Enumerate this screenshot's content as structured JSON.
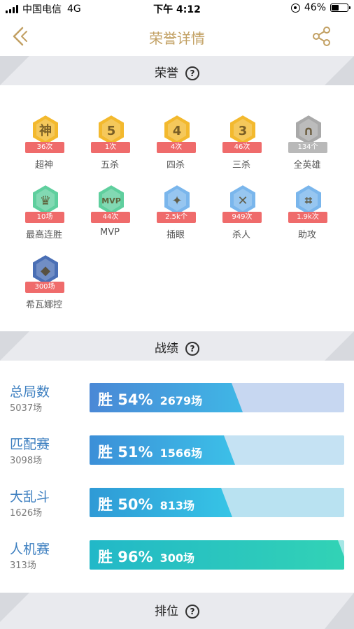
{
  "status_bar": {
    "carrier": "中国电信",
    "network": "4G",
    "time": "下午 4:12",
    "battery_text": "46%",
    "battery_level": 0.46
  },
  "nav": {
    "title": "荣誉详情",
    "back_icon": "chevron-left-icon",
    "share_icon": "share-icon",
    "accent": "#c2a063"
  },
  "sections": {
    "honor_title": "荣誉",
    "record_title": "战绩",
    "rank_title": "排位",
    "help_glyph": "?"
  },
  "honors": [
    {
      "label": "超神",
      "count": "36次",
      "icon": "godlike-badge-icon",
      "glyph": "神",
      "color": "#f3b92e"
    },
    {
      "label": "五杀",
      "count": "1次",
      "icon": "penta-kill-badge-icon",
      "glyph": "5",
      "color": "#f3b92e"
    },
    {
      "label": "四杀",
      "count": "4次",
      "icon": "quadra-kill-badge-icon",
      "glyph": "4",
      "color": "#f3b92e"
    },
    {
      "label": "三杀",
      "count": "46次",
      "icon": "triple-kill-badge-icon",
      "glyph": "3",
      "color": "#f3b92e"
    },
    {
      "label": "全英雄",
      "count": "134个",
      "icon": "all-heroes-badge-icon",
      "glyph": "∩",
      "color": "#a9a9a9"
    },
    {
      "label": "最高连胜",
      "count": "10场",
      "icon": "win-streak-trophy-icon",
      "glyph": "♛",
      "color": "#5fcf9e"
    },
    {
      "label": "MVP",
      "count": "44次",
      "icon": "mvp-badge-icon",
      "glyph": "MVP",
      "color": "#5fcf9e"
    },
    {
      "label": "插眼",
      "count": "2.5k个",
      "icon": "ward-badge-icon",
      "glyph": "✦",
      "color": "#7ab6ec"
    },
    {
      "label": "杀人",
      "count": "949次",
      "icon": "kill-badge-icon",
      "glyph": "✕",
      "color": "#7ab6ec"
    },
    {
      "label": "助攻",
      "count": "1.9k次",
      "icon": "assist-badge-icon",
      "glyph": "⌗",
      "color": "#7ab6ec"
    },
    {
      "label": "希瓦娜控",
      "count": "300场",
      "icon": "hero-portrait-badge-icon",
      "glyph": "◆",
      "color": "#4a6fb5"
    }
  ],
  "records": [
    {
      "title": "总局数",
      "games": "5037场",
      "win_text": "胜 54%",
      "win_rate": 0.54,
      "wins": "2679场",
      "fill": "#4a88d6",
      "fill2": "#3fb7e6",
      "track": "#c7d7f1"
    },
    {
      "title": "匹配赛",
      "games": "3098场",
      "win_text": "胜 51%",
      "win_rate": 0.51,
      "wins": "1566场",
      "fill": "#3c8fd8",
      "fill2": "#3cc0e8",
      "track": "#c5e2f3"
    },
    {
      "title": "大乱斗",
      "games": "1626场",
      "win_text": "胜 50%",
      "win_rate": 0.5,
      "wins": "813场",
      "fill": "#2f9ad6",
      "fill2": "#36c5e6",
      "track": "#b9e2f1"
    },
    {
      "title": "人机赛",
      "games": "313场",
      "win_text": "胜 96%",
      "win_rate": 0.96,
      "wins": "300场",
      "fill": "#22b8c8",
      "fill2": "#32d3b5",
      "track": "#a5e7e6"
    }
  ]
}
